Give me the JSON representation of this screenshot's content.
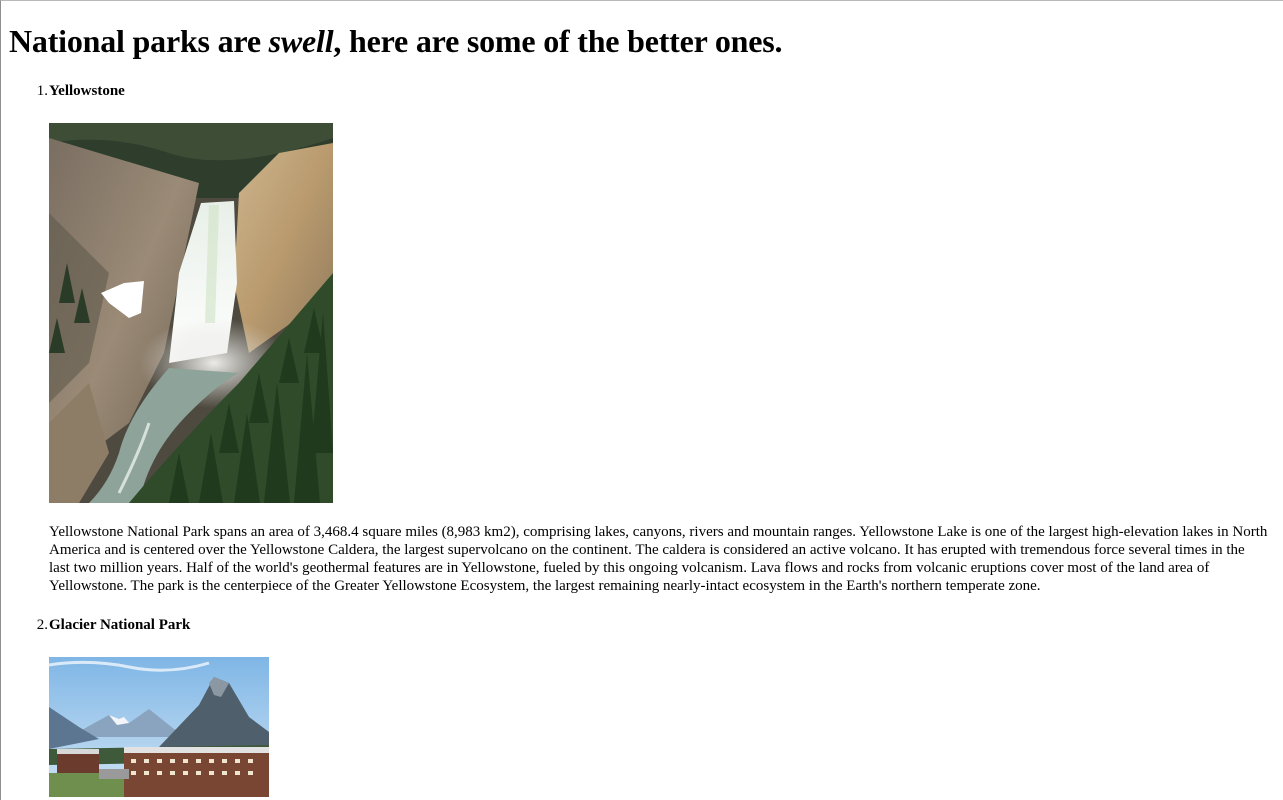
{
  "heading": {
    "before": "National parks are ",
    "emphasis": "swell",
    "after": ", here are some of the better ones."
  },
  "parks": [
    {
      "number": "1.",
      "name": "Yellowstone",
      "image_subject": "waterfall-canyon-photo",
      "description": "Yellowstone National Park spans an area of 3,468.4 square miles (8,983 km2), comprising lakes, canyons, rivers and mountain ranges. Yellowstone Lake is one of the largest high-elevation lakes in North America and is centered over the Yellowstone Caldera, the largest supervolcano on the continent. The caldera is considered an active volcano. It has erupted with tremendous force several times in the last two million years. Half of the world's geothermal features are in Yellowstone, fueled by this ongoing volcanism. Lava flows and rocks from volcanic eruptions cover most of the land area of Yellowstone. The park is the centerpiece of the Greater Yellowstone Ecosystem, the largest remaining nearly-intact ecosystem in the Earth's northern temperate zone."
    },
    {
      "number": "2.",
      "name": "Glacier National Park",
      "image_subject": "mountain-lodge-photo"
    }
  ]
}
